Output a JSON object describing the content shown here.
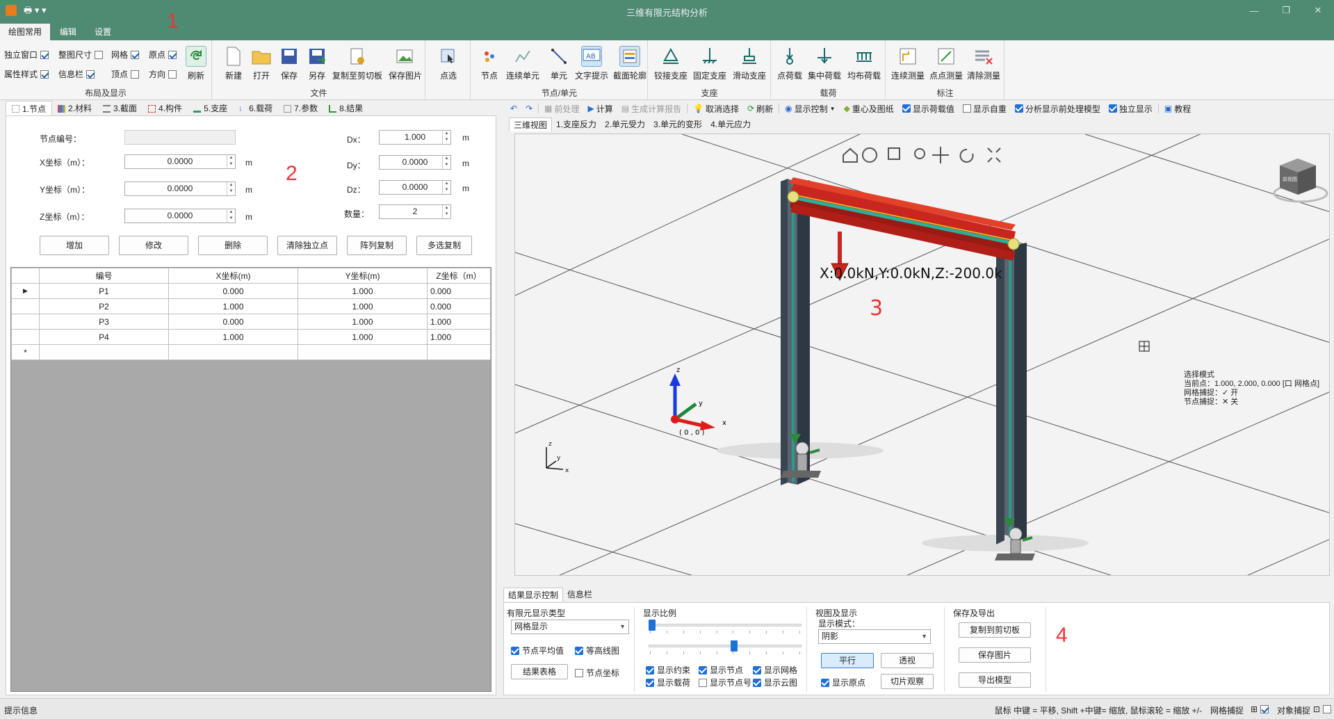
{
  "window": {
    "title": "三维有限元结构分析",
    "annot1": "1",
    "annot2": "2",
    "annot3": "3",
    "annot4": "4"
  },
  "menu": {
    "tabs": [
      "绘图常用",
      "编辑",
      "设置"
    ]
  },
  "ribbon": {
    "layout": {
      "label": "布局及显示",
      "checks": [
        {
          "label": "独立窗口",
          "checked": true
        },
        {
          "label": "整图尺寸",
          "checked": false
        },
        {
          "label": "网格",
          "checked": true
        },
        {
          "label": "原点",
          "checked": true
        },
        {
          "label": "属性样式",
          "checked": true
        },
        {
          "label": "信息栏",
          "checked": true
        },
        {
          "label": "顶点",
          "checked": false
        },
        {
          "label": "方向",
          "checked": false
        }
      ],
      "refresh": "刷新"
    },
    "file": {
      "label": "文件",
      "new": "新建",
      "open": "打开",
      "save": "保存",
      "saveas": "另存",
      "copy": "复制至剪切板",
      "savepic": "保存图片"
    },
    "select": {
      "label": "点选"
    },
    "node": {
      "label": "节点/单元",
      "node": "节点",
      "cont": "连续单元",
      "elem": "单元",
      "text": "文字提示",
      "section": "截面轮廓"
    },
    "support": {
      "label": "支座",
      "hinge": "铰接支座",
      "fixed": "固定支座",
      "slide": "滑动支座"
    },
    "load": {
      "label": "载荷",
      "point": "点荷载",
      "conc": "集中荷载",
      "dist": "均布荷载"
    },
    "mark": {
      "label": "标注",
      "cont": "连续测量",
      "pp": "点点测量",
      "clear": "清除测量"
    }
  },
  "lefttabs": [
    "1.节点",
    "2.材料",
    "3.截面",
    "4.构件",
    "5.支座",
    "6.载荷",
    "7.参数",
    "8.结果"
  ],
  "nodeform": {
    "id_label": "节点编号：",
    "x_label": "X坐标（m）：",
    "x_val": "0.0000",
    "y_label": "Y坐标（m）：",
    "y_val": "0.0000",
    "z_label": "Z坐标（m）：",
    "z_val": "0.0000",
    "dx_label": "Dx：",
    "dx_val": "1.000",
    "dy_label": "Dy：",
    "dy_val": "0.0000",
    "dz_label": "Dz：",
    "dz_val": "0.0000",
    "count_label": "数量：",
    "count_val": "2",
    "unit": "m",
    "buttons": [
      "增加",
      "修改",
      "删除",
      "清除独立点",
      "阵列复制",
      "多选复制"
    ]
  },
  "table": {
    "headers": [
      "编号",
      "X坐标(m)",
      "Y坐标(m)",
      "Z坐标（m）"
    ],
    "rows": [
      [
        "P1",
        "0.000",
        "1.000",
        "0.000"
      ],
      [
        "P2",
        "1.000",
        "1.000",
        "0.000"
      ],
      [
        "P3",
        "0.000",
        "1.000",
        "1.000"
      ],
      [
        "P4",
        "1.000",
        "1.000",
        "1.000"
      ]
    ],
    "new_marker": "*"
  },
  "viewtoolbar": {
    "pre": "前处理",
    "calc": "计算",
    "report": "生成计算报告",
    "cancel": "取消选择",
    "refresh": "刷新",
    "display": "显示控制",
    "cg": "重心及图纸",
    "loadval": "显示荷载值",
    "selfw": "显示自重",
    "premodel": "分析显示前处理模型",
    "indep": "独立显示",
    "tutorial": "教程"
  },
  "viewtabs": [
    "三维视图",
    "1.支座反力",
    "2.单元受力",
    "3.单元的变形",
    "4.单元应力"
  ],
  "viewport": {
    "load_label": "X:0.0kN,Y:0.0kN,Z:-200.0k",
    "origin": "( 0 , 0 )",
    "axis_x": "x",
    "axis_y": "y",
    "axis_z": "z",
    "cube_face": "前视图"
  },
  "snapinfo": {
    "l1": "选择模式",
    "l2": "当前点：1.000, 2.000, 0.000 [口 网格点]",
    "l3": "网格捕捉：✓ 开",
    "l4": "节点捕捉：✕ 关"
  },
  "bottomtabs": [
    "结果显示控制",
    "信息栏"
  ],
  "bottom": {
    "fe_title": "有限元显示类型",
    "fe_select": "网格显示",
    "avg": "节点平均值",
    "contour": "等高线图",
    "table_btn": "结果表格",
    "coord": "节点坐标",
    "scale_title": "显示比例",
    "c1": "显示约束",
    "c2": "显示节点",
    "c3": "显示网格",
    "c4": "显示载荷",
    "c5": "显示节点号",
    "c6": "显示云图",
    "view_title": "视图及显示",
    "mode_label": "显示模式：",
    "mode_select": "阴影",
    "parallel": "平行",
    "persp": "透视",
    "origin": "显示原点",
    "slice": "切片观察",
    "save_title": "保存及导出",
    "copy": "复制到剪切板",
    "savepic": "保存图片",
    "export": "导出模型"
  },
  "status": {
    "left": "提示信息",
    "right": "鼠标 中键 = 平移, Shift +中键= 缩放, 鼠标滚轮 = 缩放 +/-",
    "gridsnap": "网格捕捉",
    "objsnap": "对象捕捉"
  },
  "colors": {
    "accent": "#4f8a72",
    "beam": "#c8261e",
    "column": "#3a4552",
    "check": "#1f6fd6"
  }
}
